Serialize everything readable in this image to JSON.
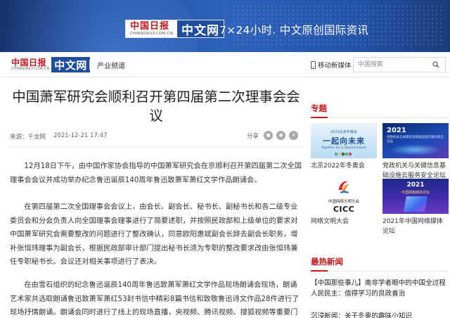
{
  "banner": {
    "logo_cn": "中国日报",
    "logo_en": "CHINADAILY.COM.CN",
    "logo_zw": "中文网",
    "slogan": "7×24小时. 中文原创国际资讯"
  },
  "nav": {
    "logo_cn": "中国日报",
    "logo_en": "CHINADAILY.COM.CN",
    "logo_zw": "中文网",
    "channel": "产业频道",
    "mobile": "移动新媒体",
    "search_placeholder": "中国搜索"
  },
  "article": {
    "title": "中国萧军研究会顺利召开第四届第二次理事会会议",
    "source": "来源：千龙网",
    "time": "2021-12-21 17:47",
    "share_label": "分享",
    "paragraphs": [
      "12月18日下午，由中国作家协会指导的中国萧军研究会在京顺利召开第四届第二次全国理事会会议并成功举办纪念鲁迅诞辰140周年鲁迅致萧军萧红文学作品朗诵会。",
      "在第四届第二次全国理事会会议上，由会长、副会长、秘书长、副秘书长和各二级专业委员会和分会负责人向全国理事会理事进行了简要述职，并按照民政部和上级单位的要求对中国萧军研究会需要整改的问题进行了整改确认，同意欧阳惠斌副会长辞去副会长职务，增补张恒玮理事为副会长，根据民政部审计部门提出秘书长须为专职的整改要求改由张恒玮兼任专职秘书长。会议还对相关事项进行了表决。",
      "在由雪石组织的纪念鲁迅诞辰140周年鲁迅致萧军萧红文学作品现场朗诵会现场，朗诵艺术家共选取朗诵鲁迅致萧军萧红53封书信中精彩8篇书信和致敬鲁迅诗文作品28件进行了现场抒情朗诵。朗诵会同时进行了线上的现场直播，央视频、腾讯视频、搜狐视频等重要门户网"
    ]
  },
  "sidebar": {
    "special_title": "专题",
    "topics": [
      {
        "caption": "北京2022年冬奥会",
        "img_small": "2022北京冬奥会",
        "img_big": "一起向未来",
        "img_en": "Together for a Shared Future"
      },
      {
        "caption": "党政机关与关键信息基础设施云服务安全论坛",
        "img_year": "2021",
        "img_line": "党政机关与关键信息基础设施云服务安全论坛"
      },
      {
        "caption": "网络文明大会",
        "img_cn": "中国网络文明大会",
        "img_abbr": "CICC"
      },
      {
        "caption": "2021年中国网络媒体论坛",
        "img_year": "2021",
        "img_line": "中国网络媒体论坛"
      }
    ],
    "latest_title": "最热新闻",
    "news": [
      "【中国那些事儿】南非学者眼中的中国全过程人民民主：值得学习的良政善治",
      "沉浸新闻：关于冬奥的趣味小知识"
    ]
  },
  "colors": {
    "brand_red": "#c8161d",
    "brand_blue": "#1f4ea0",
    "banner_blue": "#2454aa"
  },
  "icons": [
    "phone-icon",
    "search-icon",
    "wechat-icon",
    "weibo-icon",
    "plus-icon"
  ]
}
